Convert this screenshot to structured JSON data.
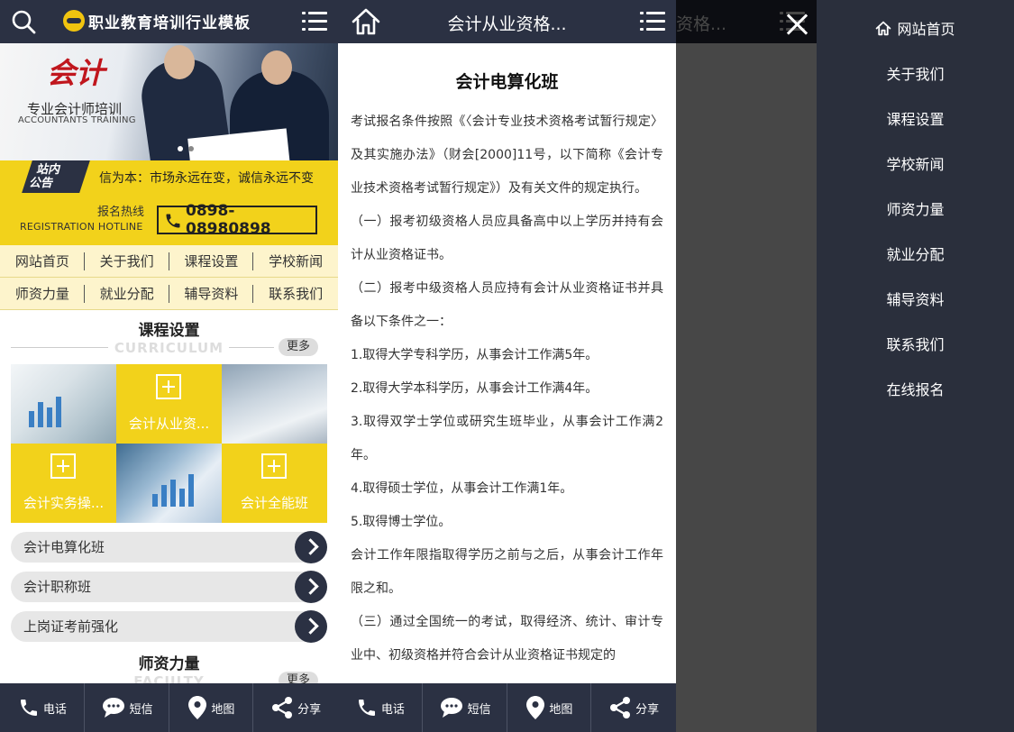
{
  "home": {
    "logo_text": "职业教育培训行业模板",
    "banner": {
      "title": "会计",
      "subtitle": "专业会计师培训",
      "subtitle_en": "ACCOUNTANTS TRAINING"
    },
    "notice": {
      "badge_line1": "站内",
      "badge_line2": "公告",
      "text": "信为本：市场永远在变，诚信永远不变"
    },
    "hotline": {
      "label": "报名热线",
      "label_en": "REGISTRATION HOTLINE",
      "phone": "0898-08980898"
    },
    "nav": [
      "网站首页",
      "关于我们",
      "课程设置",
      "学校新闻",
      "师资力量",
      "就业分配",
      "辅导资料",
      "联系我们"
    ],
    "curriculum": {
      "title": "课程设置",
      "title_en": "CURRICULUM",
      "more": "更多",
      "tiles": [
        "会计从业资...",
        "会计实务操...",
        "会计全能班"
      ],
      "list": [
        "会计电算化班",
        "会计职称班",
        "上岗证考前强化"
      ]
    },
    "faculty": {
      "title": "师资力量",
      "title_en": "FACULTY",
      "more": "更多"
    }
  },
  "bottombar": [
    "电话",
    "短信",
    "地图",
    "分享"
  ],
  "article": {
    "header_title": "会计从业资格...",
    "title": "会计电算化班",
    "paragraphs": [
      "考试报名条件按照《〈会计专业技术资格考试暂行规定〉及其实施办法》（财会[2000]11号，以下简称《会计专业技术资格考试暂行规定》）及有关文件的规定执行。",
      "（一）报考初级资格人员应具备高中以上学历并持有会计从业资格证书。",
      "（二）报考中级资格人员应持有会计从业资格证书并具备以下条件之一：",
      "1.取得大学专科学历，从事会计工作满5年。",
      "2.取得大学本科学历，从事会计工作满4年。",
      "3.取得双学士学位或研究生班毕业，从事会计工作满2年。",
      "4.取得硕士学位，从事会计工作满1年。",
      "5.取得博士学位。",
      "会计工作年限指取得学历之前与之后，从事会计工作年限之和。",
      "（三）通过全国统一的考试，取得经济、统计、审计专业中、初级资格并符合会计从业资格证书规定的"
    ]
  },
  "menu": [
    "网站首页",
    "关于我们",
    "课程设置",
    "学校新闻",
    "师资力量",
    "就业分配",
    "辅导资料",
    "联系我们",
    "在线报名"
  ],
  "colors": {
    "dark": "#2b3143",
    "yellow": "#f2d21b",
    "menu_bg": "#2a2f3c"
  }
}
